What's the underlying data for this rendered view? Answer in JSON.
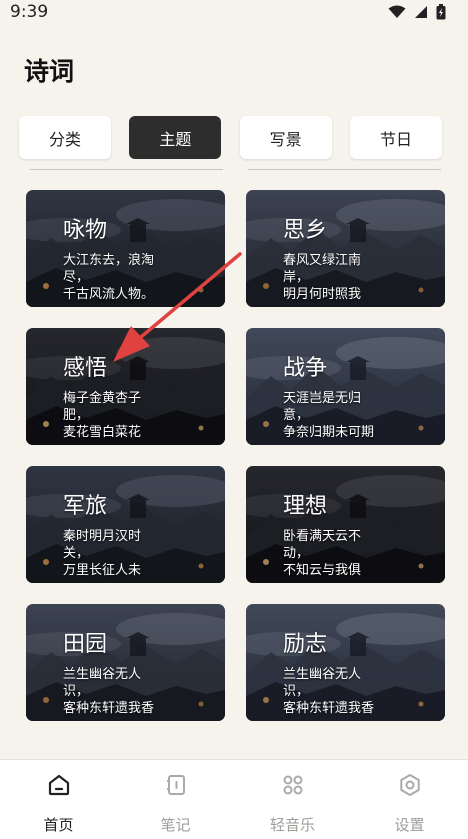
{
  "status": {
    "time": "9:39"
  },
  "header": {
    "title": "诗词"
  },
  "tabs": [
    {
      "label": "分类",
      "active": false
    },
    {
      "label": "主题",
      "active": true
    },
    {
      "label": "写景",
      "active": false
    },
    {
      "label": "节日",
      "active": false
    }
  ],
  "cards": [
    {
      "title": "咏物",
      "verse": "大江东去，浪淘\n尽，\n千古风流人物。"
    },
    {
      "title": "思乡",
      "verse": "春风又绿江南\n岸，\n明月何时照我"
    },
    {
      "title": "感悟",
      "verse": "梅子金黄杏子\n肥，\n麦花雪白菜花"
    },
    {
      "title": "战争",
      "verse": "天涯岂是无归\n意，\n争奈归期未可期"
    },
    {
      "title": "军旅",
      "verse": "秦时明月汉时\n关，\n万里长征人未"
    },
    {
      "title": "理想",
      "verse": "卧看满天云不\n动，\n不知云与我俱"
    },
    {
      "title": "田园",
      "verse": "兰生幽谷无人\n识，\n客种东轩遗我香"
    },
    {
      "title": "励志",
      "verse": "兰生幽谷无人\n识，\n客种东轩遗我香"
    }
  ],
  "bottom_nav": [
    {
      "label": "首页",
      "icon": "home-icon",
      "active": true
    },
    {
      "label": "笔记",
      "icon": "notebook-icon",
      "active": false
    },
    {
      "label": "轻音乐",
      "icon": "grid-icon",
      "active": false
    },
    {
      "label": "设置",
      "icon": "settings-icon",
      "active": false
    }
  ],
  "colors": {
    "accent": "#2d2d2d",
    "background": "#f6f2ec",
    "arrow": "#e0433f"
  }
}
